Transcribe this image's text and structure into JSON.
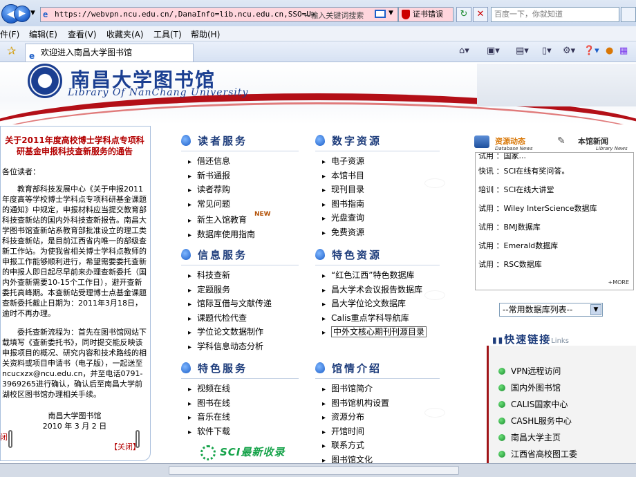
{
  "browser": {
    "url": "https://webvpn.ncu.edu.cn/,DanaInfo=lib.ncu.edu.cn,SSO=U+",
    "address_hint": "←输入关键词搜索",
    "cert_error": "证书错误",
    "search_placeholder": "百度一下，你就知道",
    "menus": [
      "件(F)",
      "编辑(E)",
      "查看(V)",
      "收藏夹(A)",
      "工具(T)",
      "帮助(H)"
    ],
    "tab_title": "欢迎进入南昌大学图书馆"
  },
  "header": {
    "name_cn": "南昌大学图书馆",
    "name_en": "Library Of NanChang University"
  },
  "notice": {
    "title": "关于2011年度高校博士学科点专项科研基金申报科技查新服务的通告",
    "greeting": "各位读者：",
    "para1": "教育部科技发展中心《关于申报2011年度高等学校博士学科点专项科研基金课题的通知》中规定，申报材料应当提交教育部科技查新站的国内外科技查新报告。南昌大学图书馆查新站系教育部批准设立的理工类科技查新站，是目前江西省内唯一的部级查新工作站。为使我省相关博士学科点教师的申报工作能够顺利进行，希望需要委托查新的申报人即日起尽早前来办理查新委托（国内外查新需要10-15个工作日），避开查新委托高峰期。本查新站受理博士点基金课题查新委托截止日期为：2011年3月18日，逾时不再办理。",
    "para2": "委托查新流程为：首先在图书馆网站下载填写《查新委托书》，同时提交能反映该申报项目的概况、研究内容和技术路线的相关资料或项目申请书（电子版），一起送至ncucxzx@ncu.edu.cn，并至电话0791-3969265进行确认，确认后至南昌大学前湖校区图书馆办理相关手续。",
    "signer": "南昌大学图书馆",
    "date": "2010 年 3 月 2 日",
    "close_label": "【关闭】",
    "side_label": "闭"
  },
  "sections": {
    "reader_service": {
      "title": "读者服务",
      "items": [
        "借还信息",
        "新书通报",
        "读者荐购",
        "常见问题",
        "新生入馆教育",
        "数据库使用指南"
      ]
    },
    "digital_resources": {
      "title": "数字资源",
      "items": [
        "电子资源",
        "本馆书目",
        "现刊目录",
        "图书指南",
        "光盘查询",
        "免费资源"
      ]
    },
    "info_service": {
      "title": "信息服务",
      "items": [
        "科技查新",
        "定题服务",
        "馆际互借与文献传递",
        "课题代检代查",
        "学位论文数据制作",
        "学科信息动态分析"
      ]
    },
    "special_resources": {
      "title": "特色资源",
      "items": [
        "“红色江西”特色数据库",
        "昌大学术会议报告数据库",
        "昌大学位论文数据库",
        "Calis重点学科导航库",
        "中外文核心期刊刊源目录"
      ]
    },
    "special_service": {
      "title": "特色服务",
      "items": [
        "视频在线",
        "图书在线",
        "音乐在线",
        "软件下载"
      ]
    },
    "library_intro": {
      "title": "馆情介绍",
      "items": [
        "图书馆简介",
        "图书馆机构设置",
        "资源分布",
        "开馆时间",
        "联系方式",
        "图书馆文化"
      ]
    },
    "sci_banner": "SCI最新收录"
  },
  "news": {
    "tab_resources": "资源动态",
    "tab_resources_en": "Database News",
    "tab_library": "本馆新闻",
    "tab_library_en": "Library News",
    "partial_top": "试用 ：国家...",
    "items": [
      {
        "type": "快讯",
        "text": "：SCI在线有奖问答。"
      },
      {
        "type": "培训",
        "text": "：SCI在线大讲堂"
      },
      {
        "type": "试用",
        "text": "：Wiley InterScience数据库"
      },
      {
        "type": "试用",
        "text": "：BMJ数据库"
      },
      {
        "type": "试用",
        "text": "：Emerald数据库"
      },
      {
        "type": "试用",
        "text": "：RSC数据库"
      }
    ],
    "more": "+MORE"
  },
  "db_select": {
    "selected": "--常用数据库列表--"
  },
  "quick_links": {
    "title": "快速链接",
    "title_en": "Links",
    "items": [
      "VPN远程访问",
      "国内外图书馆",
      "CALIS国家中心",
      "CASHL服务中心",
      "南昌大学主页",
      "江西省高校图工委"
    ]
  },
  "colors": {
    "accent_red": "#b30f17",
    "title_blue": "#1d3c7b",
    "notice_red": "#b30000"
  }
}
